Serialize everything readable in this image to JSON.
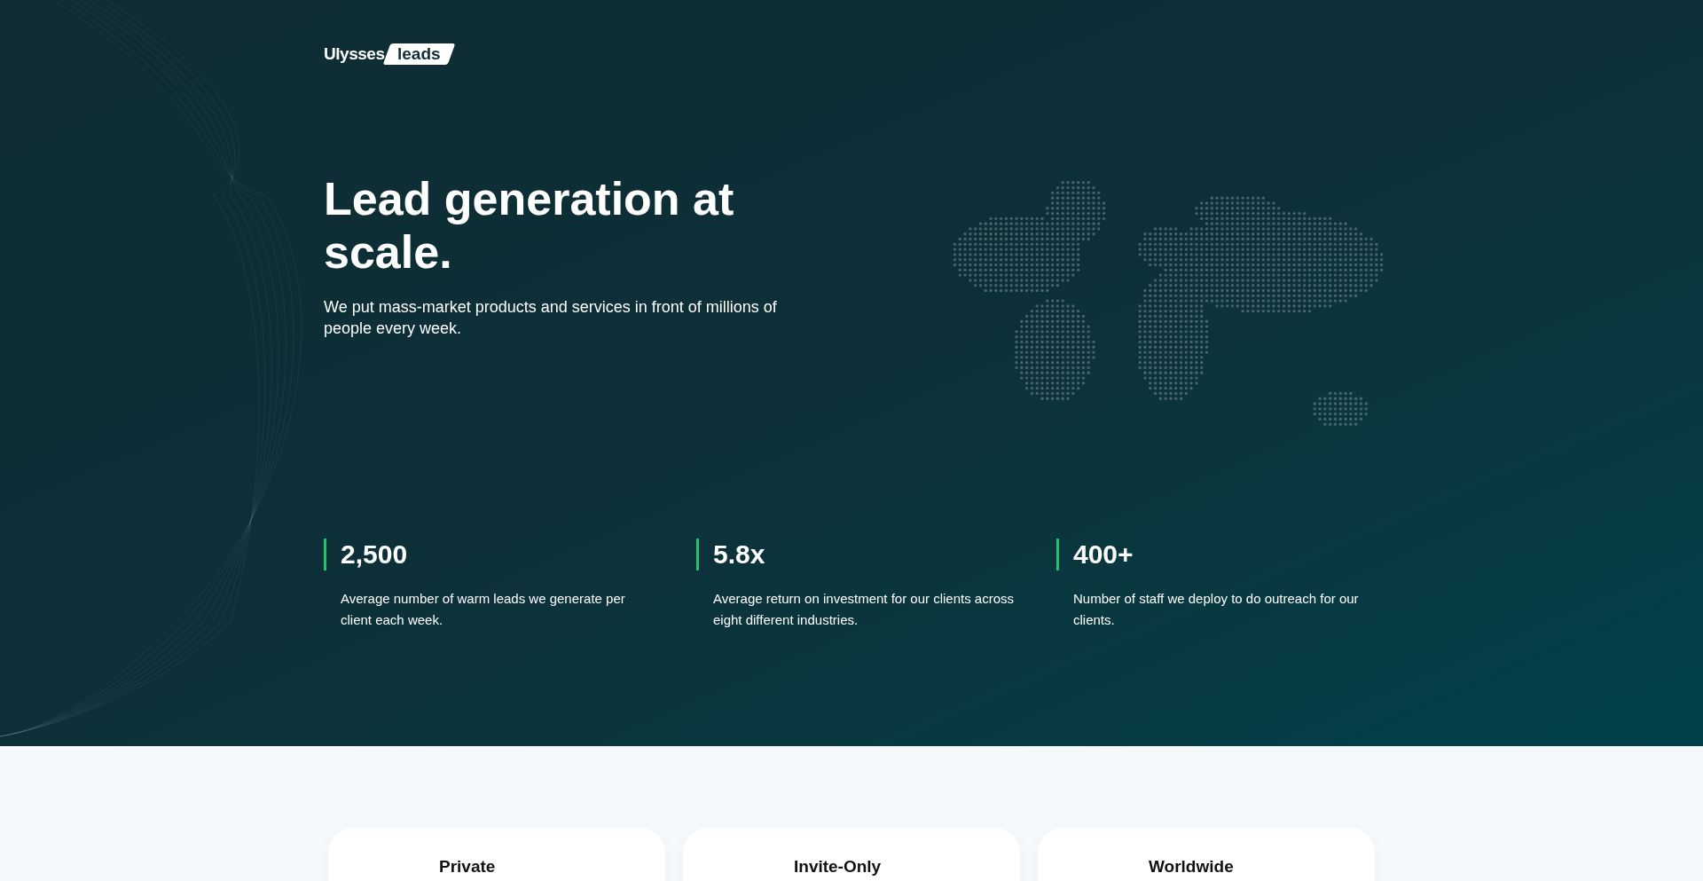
{
  "logo": {
    "name": "Ulysses",
    "badge": "leads"
  },
  "hero": {
    "headline": "Lead generation at scale.",
    "subtitle": "We put mass-market products and services in front of millions of people every week."
  },
  "stats": [
    {
      "value": "2,500",
      "description": "Average number of warm leads we generate per client each week."
    },
    {
      "value": "5.8x",
      "description": "Average return on investment for our clients across eight different industries."
    },
    {
      "value": "400+",
      "description": "Number of staff we deploy to do outreach for our clients."
    }
  ],
  "features": [
    {
      "title": "Private"
    },
    {
      "title": "Invite-Only"
    },
    {
      "title": "Worldwide"
    }
  ]
}
